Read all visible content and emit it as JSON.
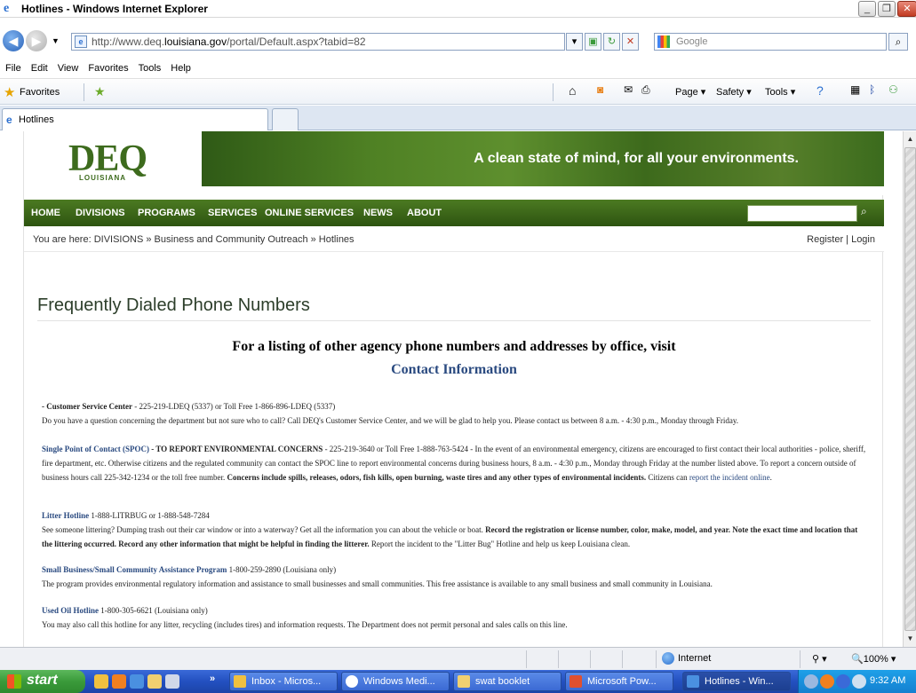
{
  "window": {
    "title": "Hotlines - Windows Internet Explorer"
  },
  "address": {
    "url_prefix": "http://www.deq.",
    "url_domain": "louisiana.gov",
    "url_suffix": "/portal/Default.aspx?tabid=82",
    "search_placeholder": "Google"
  },
  "menu": [
    "File",
    "Edit",
    "View",
    "Favorites",
    "Tools",
    "Help"
  ],
  "favorites": {
    "label": "Favorites"
  },
  "command_bar": {
    "page": "Page",
    "safety": "Safety",
    "tools": "Tools"
  },
  "tab": {
    "label": "Hotlines"
  },
  "site": {
    "logo": "DEQ",
    "logo_sub": "LOUISIANA",
    "tagline": "A clean state of mind, for all your environments.",
    "nav": [
      "HOME",
      "DIVISIONS",
      "PROGRAMS",
      "SERVICES",
      "ONLINE SERVICES",
      "NEWS",
      "ABOUT"
    ],
    "breadcrumb": "You are here: DIVISIONS » Business and Community Outreach » Hotlines",
    "register_login": "Register | Login"
  },
  "content": {
    "title": "Frequently Dialed Phone Numbers",
    "agency_line": "For a listing of other agency phone numbers and addresses by office, visit",
    "contact_link": "Contact Information",
    "csc": {
      "heading": " - Customer Service Center",
      "phones": " - 225-219-LDEQ (5337) or Toll Free 1-866-896-LDEQ (5337)",
      "body": "Do you have a question concerning the department but not sure who to call? Call DEQ's Customer Service Center, and we will be glad to help you. Please contact us between 8 a.m. - 4:30 p.m., Monday through Friday."
    },
    "spoc": {
      "heading": "Single Point of Contact (SPOC)",
      "bold": " - TO REPORT ENVIRONMENTAL CONCERNS",
      "body1": " - 225-219-3640 or Toll Free 1-888-763-5424 - In the event of an environmental emergency, citizens are encouraged to first contact their local authorities - police, sheriff, fire department, etc.  Otherwise citizens and the regulated community can  contact the SPOC line to report environmental concerns during business hours, 8 a.m. - 4:30 p.m., Monday through Friday at the number listed above. To report a concern outside of business hours call 225-342-1234 or the toll free number. ",
      "bold2": "Concerns include spills, releases, odors, fish kills, open burning, waste tires and any other types of environmental incidents.",
      "body2": "  Citizens can ",
      "link": "report the incident online",
      "end": "."
    },
    "litter": {
      "heading": "Litter Hotline",
      "phones": " 1-888-LITRBUG or 1-888-548-7284",
      "body1": "See someone littering? Dumping trash out their car window or into a waterway? Get all the information you can about the vehicle or boat. ",
      "bold": "Record the registration or license number, color, make, model, and year. Note the exact time and location that the littering occurred. Record any other information that might be helpful in finding the litterer.",
      "body2": " Report the incident to the \"Litter Bug\" Hotline and help us keep Louisiana clean."
    },
    "smallbiz": {
      "heading": "Small Business/Small Community Assistance Program",
      "phones": " 1-800-259-2890 (Louisiana only)",
      "body": "The program provides environmental regulatory information and assistance to small businesses and small communities. This free assistance is available to any small business and small community in Louisiana."
    },
    "usedoil": {
      "heading": "Used Oil Hotline",
      "phones": " 1-800-305-6621  (Louisiana only)",
      "body": "You may also call this hotline for any litter, recycling (includes tires) and information requests. The Department does not permit personal and sales calls on this line."
    }
  },
  "status": {
    "zone": "Internet",
    "zoom": "100%"
  },
  "taskbar": {
    "start": "start",
    "buttons": [
      "Inbox - Micros...",
      "Windows Medi...",
      "swat booklet",
      "Microsoft Pow...",
      "Hotlines - Win..."
    ],
    "clock": "9:32 AM"
  }
}
